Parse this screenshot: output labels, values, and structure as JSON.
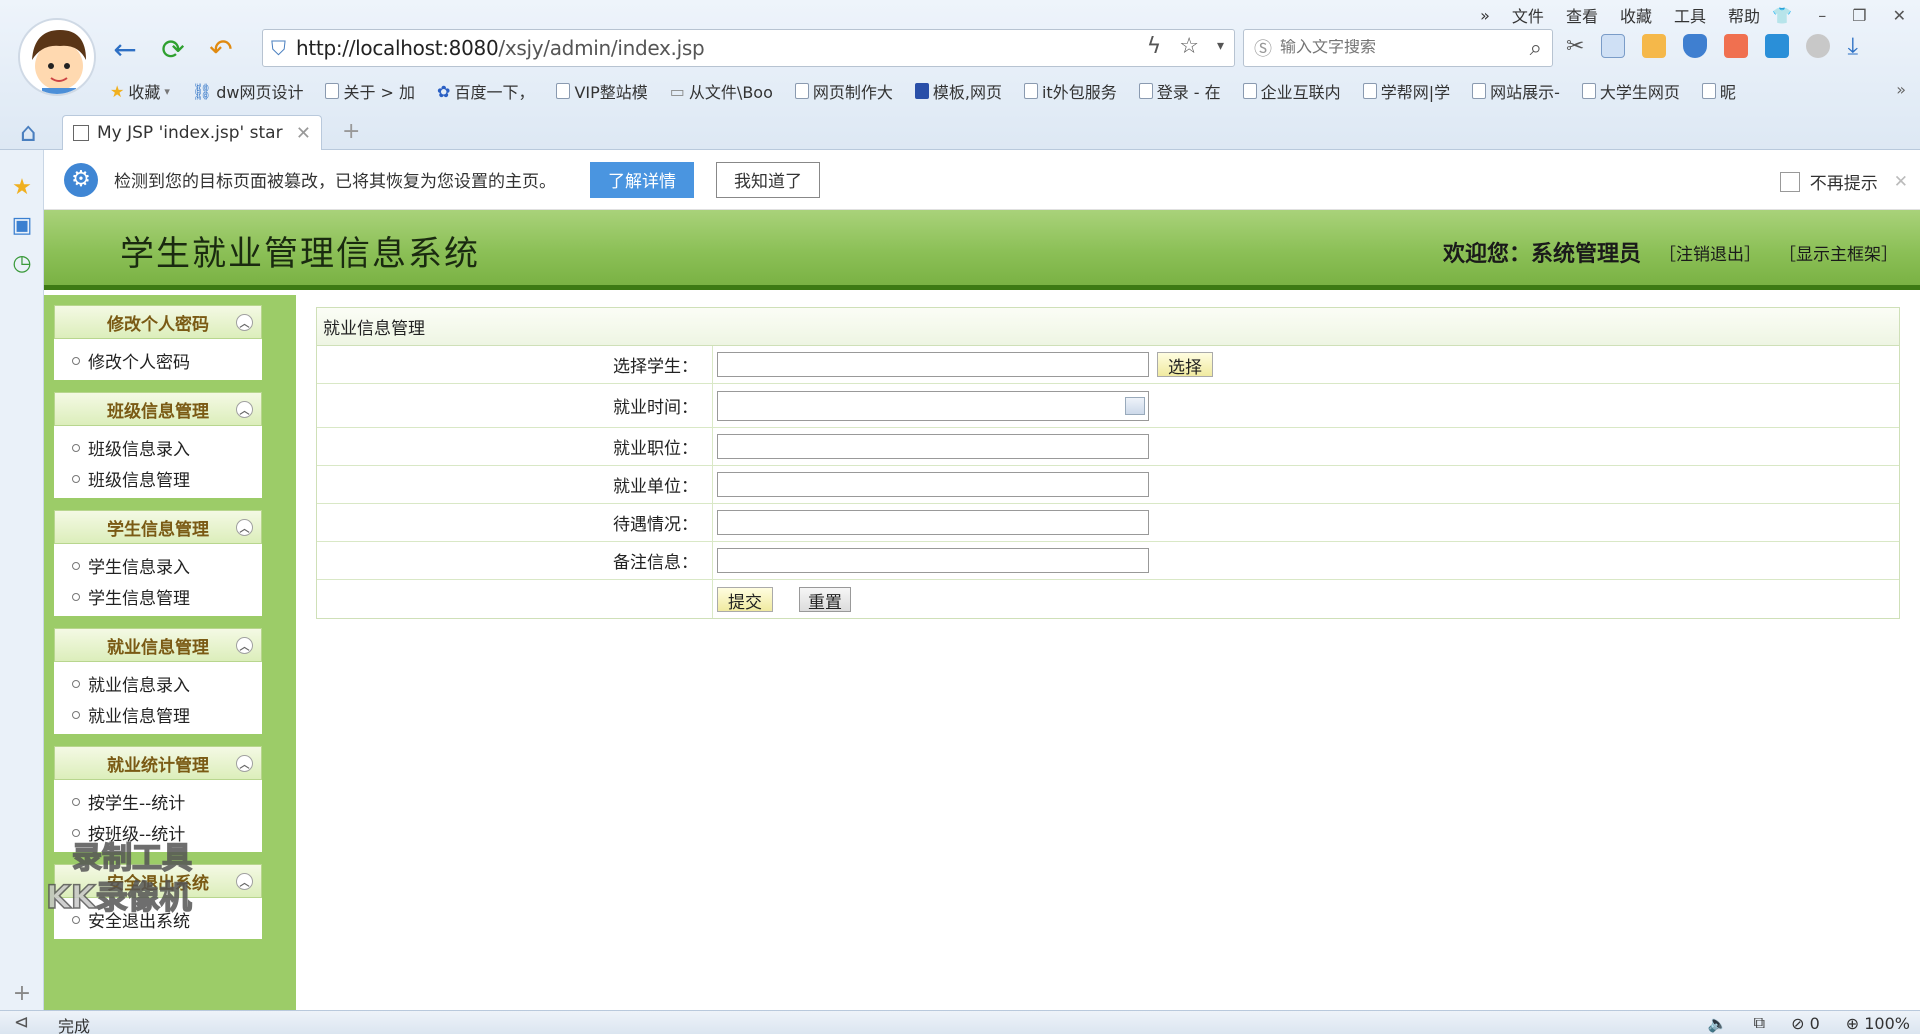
{
  "browser": {
    "menu": [
      "文件",
      "查看",
      "收藏",
      "工具",
      "帮助"
    ],
    "menu_more": "»",
    "url_host": "http://localhost:8080",
    "url_path": "/xsjy/admin/index.jsp",
    "search_placeholder": "输入文字搜索",
    "bookmarks": [
      "收藏",
      "dw网页设计",
      "关于 > 加",
      "百度一下，",
      "VIP整站模",
      "从文件\\Boo",
      "网页制作大",
      "模板,网页",
      "it外包服务",
      "登录 - 在",
      "企业互联内",
      "学帮网|学",
      "网站展示-",
      "大学生网页",
      "昵"
    ],
    "bookmarks_more": "»",
    "tab_title": "My JSP 'index.jsp' star",
    "new_tab": "+",
    "status_text": "完成",
    "status_zero": "0",
    "zoom": "100%",
    "colors": {
      "chrome": "#dde8f4",
      "accent": "#4a95e0"
    }
  },
  "notify": {
    "message": "检测到您的目标页面被篡改，已将其恢复为您设置的主页。",
    "details_button": "了解详情",
    "ok_button": "我知道了",
    "dont_show": "不再提示"
  },
  "app": {
    "title": "学生就业管理信息系统",
    "welcome": "欢迎您：系统管理员",
    "logout": "［注销退出］",
    "show_frame": "［显示主框架］",
    "colors": {
      "header": "#8cc057",
      "header_border": "#3d7a14",
      "sidebar": "#9ccc68",
      "menu_head_text": "#7a5a14"
    }
  },
  "sidebar": {
    "groups": [
      {
        "title": "修改个人密码",
        "items": [
          "修改个人密码"
        ]
      },
      {
        "title": "班级信息管理",
        "items": [
          "班级信息录入",
          "班级信息管理"
        ]
      },
      {
        "title": "学生信息管理",
        "items": [
          "学生信息录入",
          "学生信息管理"
        ]
      },
      {
        "title": "就业信息管理",
        "items": [
          "就业信息录入",
          "就业信息管理"
        ]
      },
      {
        "title": "就业统计管理",
        "items": [
          "按学生--统计",
          "按班级--统计"
        ]
      },
      {
        "title": "安全退出系统",
        "items": [
          "安全退出系统"
        ]
      }
    ]
  },
  "form": {
    "title": "就业信息管理",
    "fields": [
      {
        "label": "选择学生：",
        "value": ""
      },
      {
        "label": "就业时间：",
        "value": ""
      },
      {
        "label": "就业职位：",
        "value": ""
      },
      {
        "label": "就业单位：",
        "value": ""
      },
      {
        "label": "待遇情况：",
        "value": ""
      },
      {
        "label": "备注信息：",
        "value": ""
      }
    ],
    "select_button": "选择",
    "submit_button": "提交",
    "reset_button": "重置"
  },
  "watermark": {
    "line1": "录制工具",
    "line2": "KK录像机"
  }
}
